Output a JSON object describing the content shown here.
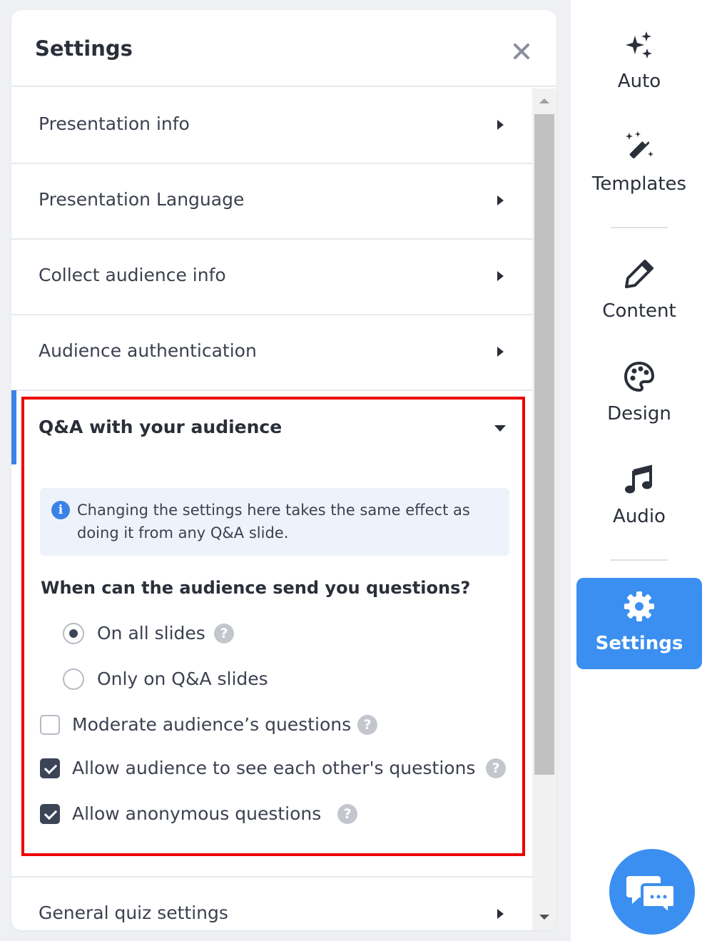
{
  "panel": {
    "title": "Settings",
    "close_icon": "close-icon",
    "sections": [
      {
        "label": "Presentation info",
        "expanded": false
      },
      {
        "label": "Presentation Language",
        "expanded": false
      },
      {
        "label": "Collect audience info",
        "expanded": false
      },
      {
        "label": "Audience authentication",
        "expanded": false
      },
      {
        "label": "Q&A with your audience",
        "expanded": true
      },
      {
        "label": "General quiz settings",
        "expanded": false
      }
    ],
    "qa": {
      "info_text": "Changing the settings here takes the same effect as doing it from any Q&A slide.",
      "question": "When can the audience send you questions?",
      "radio_options": [
        {
          "label": "On all slides",
          "selected": true,
          "has_help": true
        },
        {
          "label": "Only on Q&A slides",
          "selected": false,
          "has_help": false
        }
      ],
      "checkboxes": [
        {
          "label": "Moderate audience’s questions",
          "checked": false
        },
        {
          "label": "Allow audience to see each other's questions",
          "checked": true
        },
        {
          "label": "Allow anonymous questions",
          "checked": true
        }
      ],
      "help_glyph": "?",
      "info_glyph": "i"
    }
  },
  "rail": {
    "tools": [
      {
        "label": "Auto",
        "icon": "sparkles-icon",
        "active": false
      },
      {
        "label": "Templates",
        "icon": "magic-wand-icon",
        "active": false
      },
      {
        "label": "Content",
        "icon": "pencil-icon",
        "active": false
      },
      {
        "label": "Design",
        "icon": "palette-icon",
        "active": false
      },
      {
        "label": "Audio",
        "icon": "music-note-icon",
        "active": false
      },
      {
        "label": "Settings",
        "icon": "gear-icon",
        "active": true
      }
    ],
    "chat_icon": "chat-bubbles-icon"
  },
  "colors": {
    "accent": "#3b8ff0",
    "highlight": "#ee0000",
    "text": "#3c4150",
    "info_bg": "#eef3fb"
  }
}
